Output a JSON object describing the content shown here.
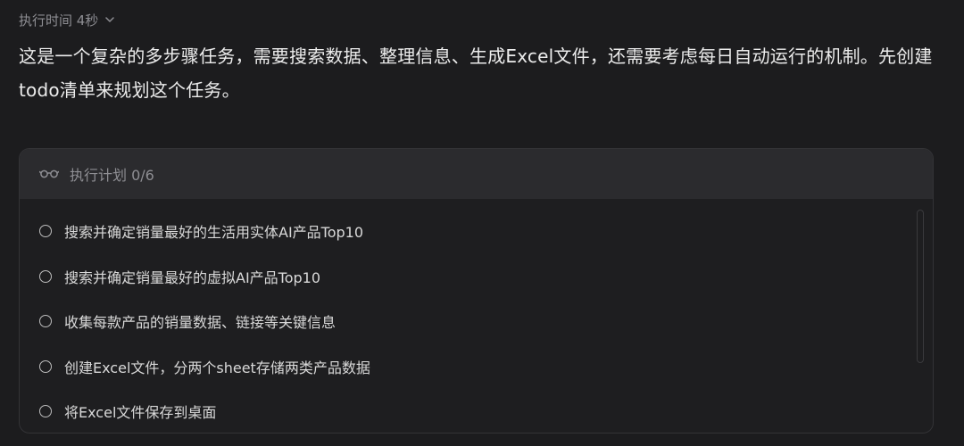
{
  "header": {
    "exec_time_label": "执行时间 4秒"
  },
  "message": {
    "text": "这是一个复杂的多步骤任务，需要搜索数据、整理信息、生成Excel文件，还需要考虑每日自动运行的机制。先创建todo清单来规划这个任务。"
  },
  "plan": {
    "title": "执行计划 0/6",
    "items": [
      {
        "label": "搜索并确定销量最好的生活用实体AI产品Top10",
        "done": false
      },
      {
        "label": "搜索并确定销量最好的虚拟AI产品Top10",
        "done": false
      },
      {
        "label": "收集每款产品的销量数据、链接等关键信息",
        "done": false
      },
      {
        "label": "创建Excel文件，分两个sheet存储两类产品数据",
        "done": false
      },
      {
        "label": "将Excel文件保存到桌面",
        "done": false
      }
    ]
  },
  "colors": {
    "background": "#1c1c1e",
    "header_bg": "#2b2b2e",
    "muted_text": "#8e8e93",
    "body_text": "#ececec"
  }
}
